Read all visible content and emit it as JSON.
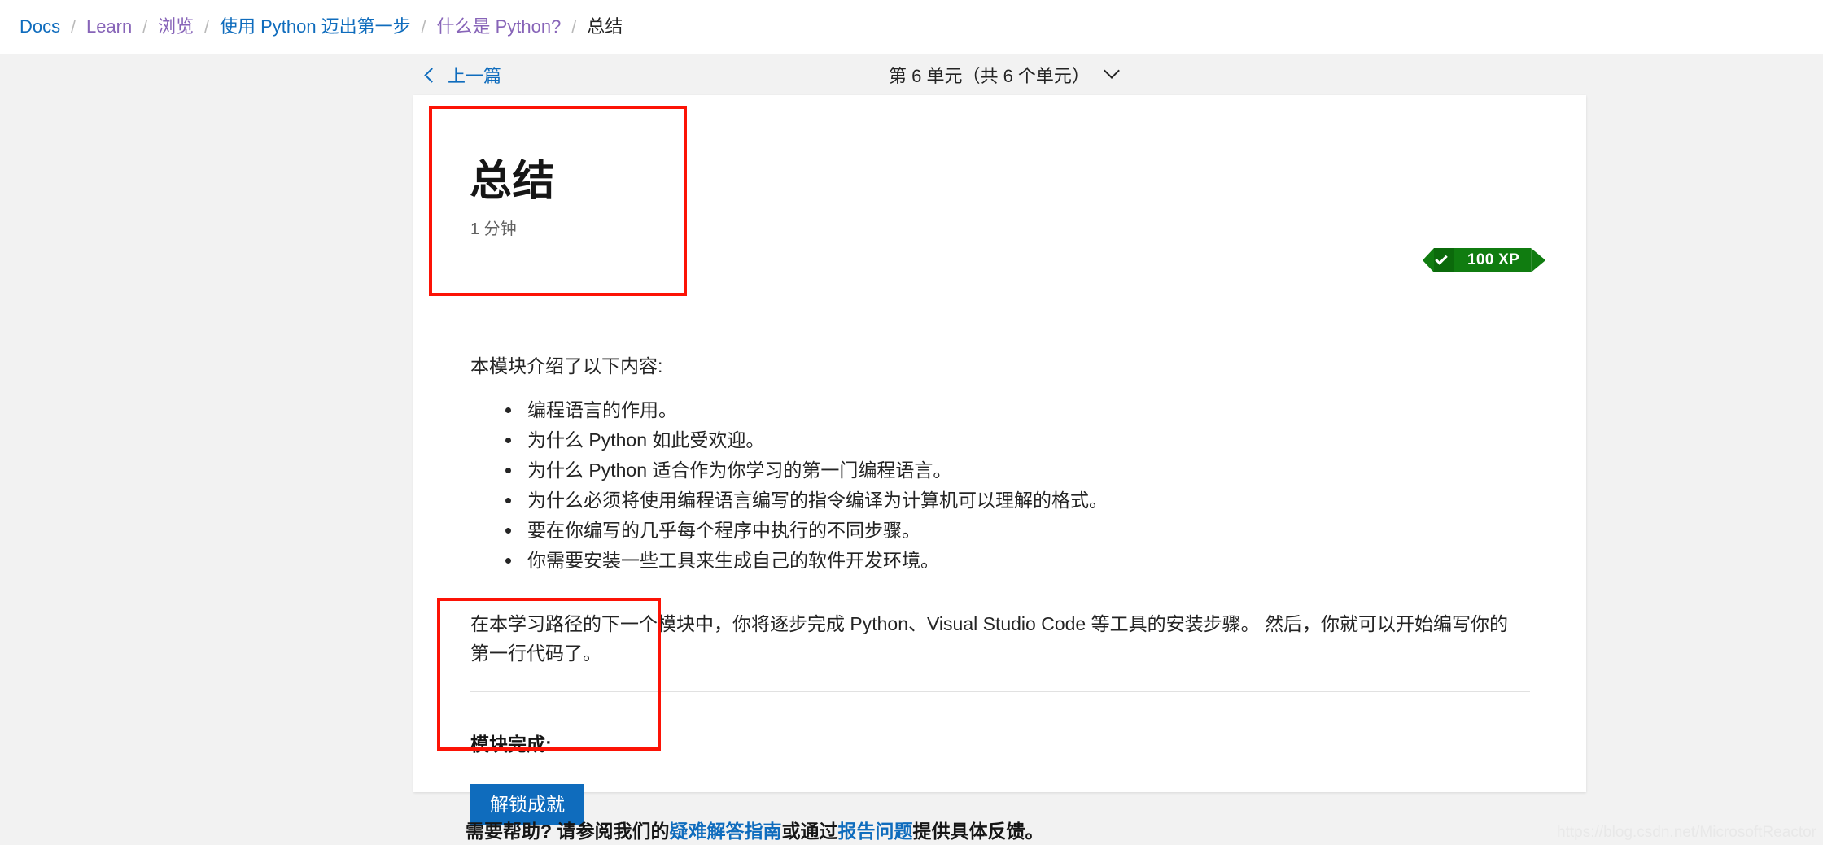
{
  "breadcrumb": {
    "separator": "/",
    "items": [
      {
        "label": "Docs",
        "state": "link"
      },
      {
        "label": "Learn",
        "state": "visited"
      },
      {
        "label": "浏览",
        "state": "visited"
      },
      {
        "label": "使用 Python 迈出第一步",
        "state": "link"
      },
      {
        "label": "什么是 Python?",
        "state": "visited"
      },
      {
        "label": "总结",
        "state": "current"
      }
    ]
  },
  "unit_nav": {
    "previous_label": "上一篇",
    "unit_selector_label": "第 6 单元（共 6 个单元）",
    "prev_icon": "chevron-left-icon",
    "dropdown_icon": "chevron-down-icon"
  },
  "unit": {
    "title": "总结",
    "read_time": "1 分钟",
    "xp_badge": {
      "label": "100 XP",
      "icon": "check-icon",
      "color": "#107c10",
      "accent_color": "#0b6a0b"
    },
    "intro": "本模块介绍了以下内容:",
    "bullets": [
      "编程语言的作用。",
      "为什么 Python 如此受欢迎。",
      "为什么 Python 适合作为你学习的第一门编程语言。",
      "为什么必须将使用编程语言编写的指令编译为计算机可以理解的格式。",
      "要在你编写的几乎每个程序中执行的不同步骤。",
      "你需要安装一些工具来生成自己的软件开发环境。"
    ],
    "closing_paragraph": "在本学习路径的下一个模块中，你将逐步完成 Python、Visual Studio Code 等工具的安装步骤。 然后，你就可以开始编写你的第一行代码了。",
    "completion_heading": "模块完成:",
    "unlock_button_label": "解锁成就",
    "unlock_button_color": "#0f6cbd"
  },
  "footer": {
    "help_prefix": "需要帮助? 请参阅我们的",
    "troubleshoot_link": "疑难解答指南",
    "help_middle": "或通过",
    "report_link": "报告问题",
    "help_suffix": "提供具体反馈。"
  },
  "watermark": "https://blog.csdn.net/MicrosoftReactor"
}
